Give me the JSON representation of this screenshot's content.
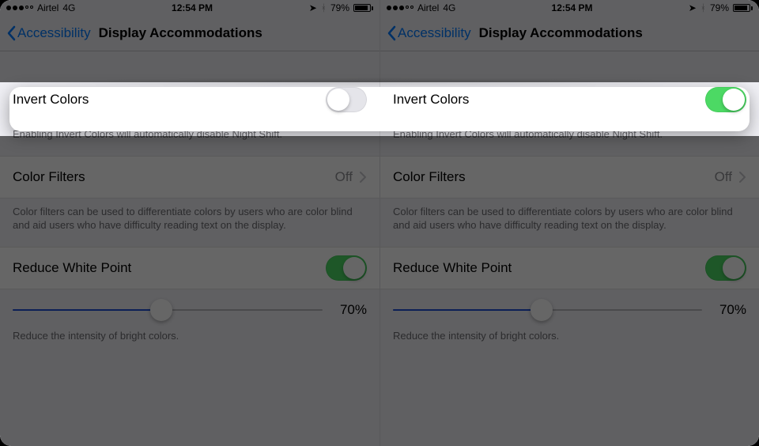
{
  "statusbar": {
    "carrier": "Airtel",
    "network": "4G",
    "time": "12:54 PM",
    "battery_pct": "79%"
  },
  "nav": {
    "back_label": "Accessibility",
    "title": "Display Accommodations"
  },
  "rows": {
    "invert_label": "Invert Colors",
    "invert_footer": "Enabling Invert Colors will automatically disable Night Shift.",
    "filters_label": "Color Filters",
    "filters_value": "Off",
    "filters_footer": "Color filters can be used to differentiate colors by users who are color blind and aid users who have difficulty reading text on the display.",
    "rwp_label": "Reduce White Point",
    "rwp_pct": "70%",
    "rwp_footer": "Reduce the intensity of bright colors."
  },
  "left": {
    "invert_on": false,
    "rwp_on": true,
    "slider_pct": 48
  },
  "right": {
    "invert_on": true,
    "rwp_on": true,
    "slider_pct": 48
  }
}
